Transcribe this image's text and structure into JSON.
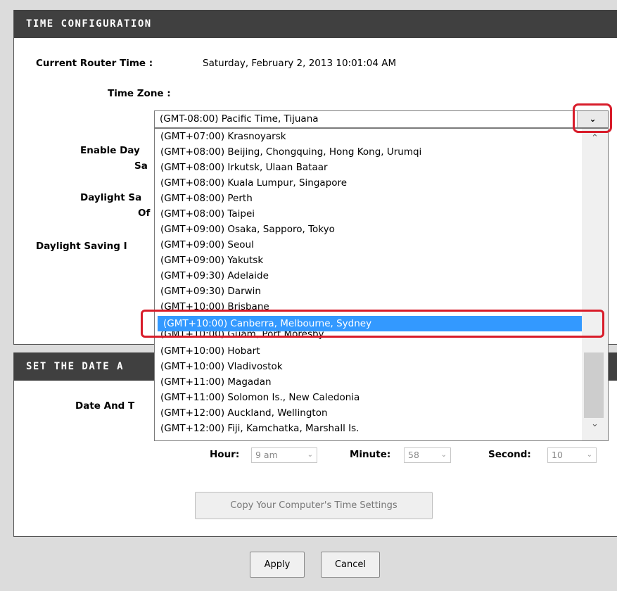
{
  "time_config": {
    "header": "TIME CONFIGURATION",
    "current_router_time_label": "Current Router Time :",
    "current_router_time_value": "Saturday, February 2, 2013 10:01:04 AM",
    "time_zone_label": "Time Zone :",
    "enable_daylight_label_1": "Enable Day",
    "enable_daylight_label_2": "Sa",
    "daylight_offset_label_1": "Daylight Sa",
    "daylight_offset_label_2": "Of",
    "daylight_dates_label": "Daylight Saving I"
  },
  "timezone_select": {
    "selected_value": "(GMT-08:00) Pacific Time, Tijuana",
    "chevron_glyph": "⌄",
    "options": [
      "(GMT+07:00) Krasnoyarsk",
      "(GMT+08:00) Beijing, Chongquing, Hong Kong, Urumqi",
      "(GMT+08:00) Irkutsk, Ulaan Bataar",
      "(GMT+08:00) Kuala Lumpur, Singapore",
      "(GMT+08:00) Perth",
      "(GMT+08:00) Taipei",
      "(GMT+09:00) Osaka, Sapporo, Tokyo",
      "(GMT+09:00) Seoul",
      "(GMT+09:00) Yakutsk",
      "(GMT+09:30) Adelaide",
      "(GMT+09:30) Darwin",
      "(GMT+10:00) Brisbane",
      "(GMT+10:00) Canberra, Melbourne, Sydney",
      "(GMT+10:00) Guam, Port Moresby",
      "(GMT+10:00) Hobart",
      "(GMT+10:00) Vladivostok",
      "(GMT+11:00) Magadan",
      "(GMT+11:00) Solomon Is., New Caledonia",
      "(GMT+12:00) Auckland, Wellington",
      "(GMT+12:00) Fiji, Kamchatka, Marshall Is."
    ],
    "highlighted_option": "(GMT+10:00) Canberra, Melbourne, Sydney",
    "scroll_up_glyph": "⌃",
    "scroll_down_glyph": "⌄"
  },
  "date_time": {
    "header": "SET THE DATE A",
    "date_and_time_label": "Date And T",
    "hour_label": "Hour:",
    "hour_value": "9 am",
    "minute_label": "Minute:",
    "minute_value": "58",
    "second_label": "Second:",
    "second_value": "10",
    "copy_button": "Copy Your Computer's Time Settings",
    "select_chevron": "⌄"
  },
  "actions": {
    "apply": "Apply",
    "cancel": "Cancel"
  },
  "colors": {
    "header_bg": "#404040",
    "highlight": "#3399ff",
    "annotation_red": "#d81c2a"
  }
}
